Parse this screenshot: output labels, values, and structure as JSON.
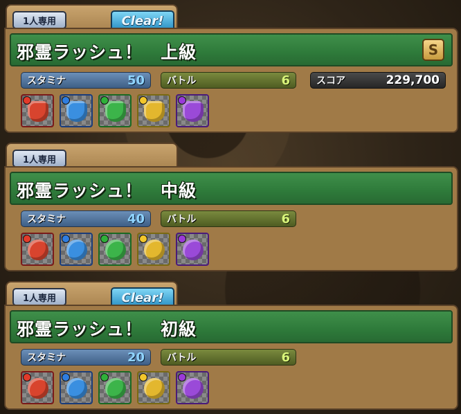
{
  "quests": [
    {
      "mode_label": "1人専用",
      "clear_label": "Clear!",
      "title": "邪霊ラッシュ！　上級",
      "rank_badge": "S",
      "stamina_label": "スタミナ",
      "stamina_value": "50",
      "battle_label": "バトル",
      "battle_value": "6",
      "score_label": "スコア",
      "score_value": "229,700",
      "rewards": [
        {
          "icon": "red-watering-can-icon",
          "color": "#d8442e",
          "orb": "#e23a2a"
        },
        {
          "icon": "blue-watering-can-icon",
          "color": "#3a8fe0",
          "orb": "#2f7de0"
        },
        {
          "icon": "green-watering-can-icon",
          "color": "#3cb44a",
          "orb": "#2fb03a"
        },
        {
          "icon": "yellow-watering-can-icon",
          "color": "#e3b72e",
          "orb": "#f2c62c"
        },
        {
          "icon": "purple-watering-can-icon",
          "color": "#9a4ad8",
          "orb": "#9a3ad8"
        }
      ]
    },
    {
      "mode_label": "1人専用",
      "title": "邪霊ラッシュ！　中級",
      "stamina_label": "スタミナ",
      "stamina_value": "40",
      "battle_label": "バトル",
      "battle_value": "6",
      "rewards": [
        {
          "icon": "red-money-bag-icon",
          "color": "#d8442e",
          "orb": "#e23a2a"
        },
        {
          "icon": "blue-money-bag-icon",
          "color": "#3a8fe0",
          "orb": "#2f7de0"
        },
        {
          "icon": "green-money-bag-icon",
          "color": "#3cb44a",
          "orb": "#2fb03a"
        },
        {
          "icon": "yellow-money-bag-icon",
          "color": "#e3b72e",
          "orb": "#f2c62c"
        },
        {
          "icon": "purple-money-bag-icon",
          "color": "#9a4ad8",
          "orb": "#9a3ad8"
        }
      ]
    },
    {
      "mode_label": "1人専用",
      "clear_label": "Clear!",
      "title": "邪霊ラッシュ！　初級",
      "stamina_label": "スタミナ",
      "stamina_value": "20",
      "battle_label": "バトル",
      "battle_value": "6",
      "rewards": [
        {
          "icon": "red-money-bag-icon",
          "color": "#d8442e",
          "orb": "#e23a2a"
        },
        {
          "icon": "blue-money-bag-icon",
          "color": "#3a8fe0",
          "orb": "#2f7de0"
        },
        {
          "icon": "green-money-bag-icon",
          "color": "#3cb44a",
          "orb": "#2fb03a"
        },
        {
          "icon": "yellow-money-bag-icon",
          "color": "#e3b72e",
          "orb": "#f2c62c"
        },
        {
          "icon": "purple-money-bag-icon",
          "color": "#9a4ad8",
          "orb": "#9a3ad8"
        }
      ]
    }
  ]
}
